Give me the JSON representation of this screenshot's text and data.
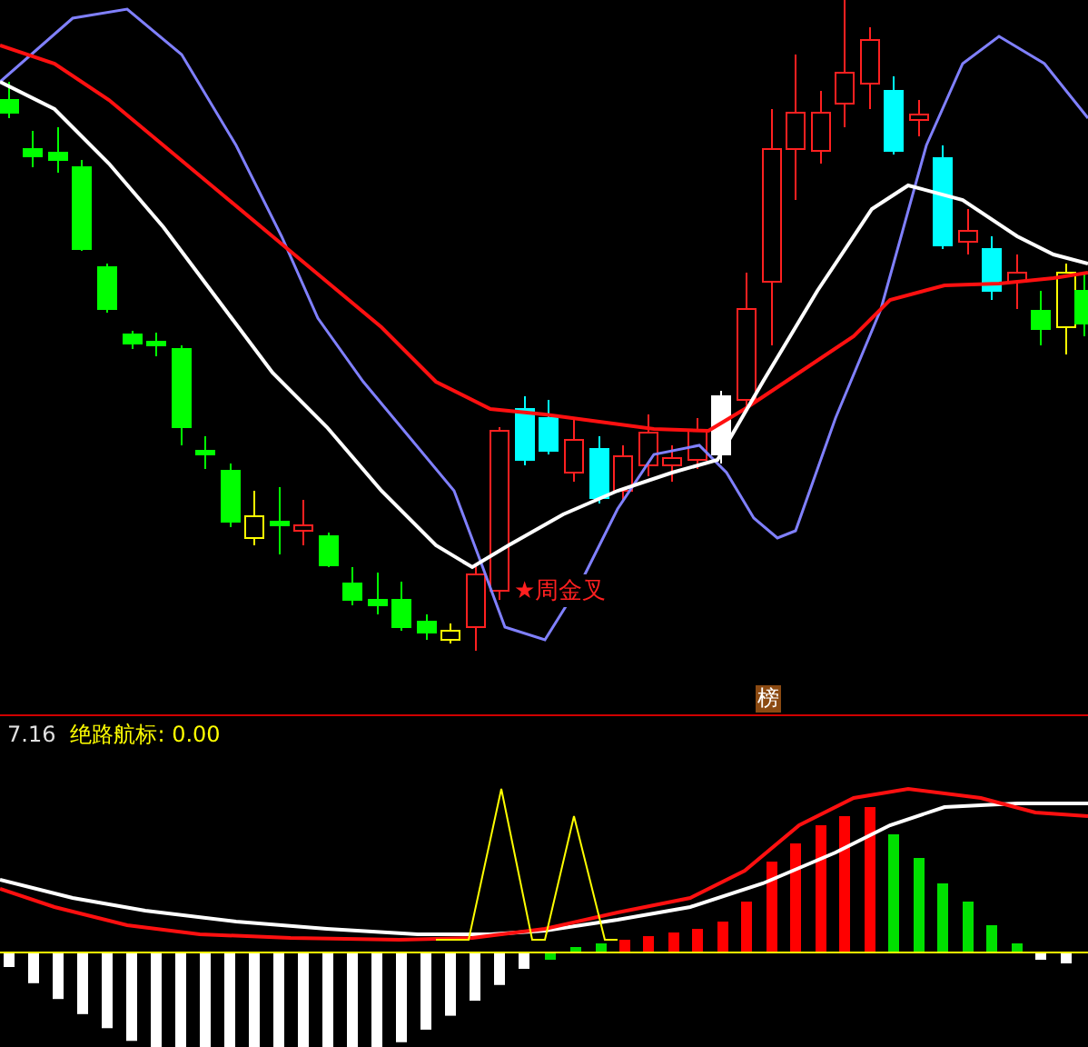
{
  "price_panel": {
    "signal_label": "★周金叉",
    "badge": "榜"
  },
  "indicator_panel": {
    "value": "7.16",
    "label": "绝路航标: 0.00"
  }
}
